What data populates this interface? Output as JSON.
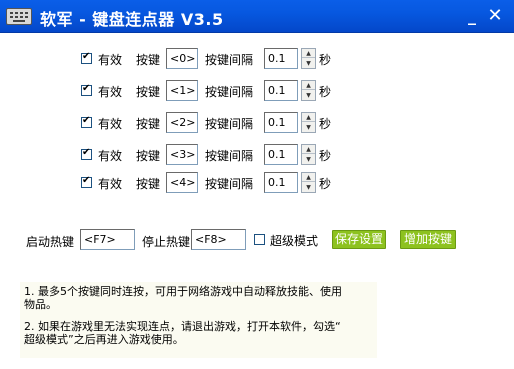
{
  "window": {
    "title": "软军 - 键盘连点器 V3.5",
    "min_label": "_",
    "close_label": "✕",
    "accent": "#0758e0"
  },
  "labels": {
    "enabled": "有效",
    "key": "按键",
    "interval": "按键间隔",
    "seconds": "秒"
  },
  "rows": [
    {
      "enabled": true,
      "key": "<0>",
      "interval": "0.1"
    },
    {
      "enabled": true,
      "key": "<1>",
      "interval": "0.1"
    },
    {
      "enabled": true,
      "key": "<2>",
      "interval": "0.1"
    },
    {
      "enabled": true,
      "key": "<3>",
      "interval": "0.1"
    },
    {
      "enabled": true,
      "key": "<4>",
      "interval": "0.1"
    }
  ],
  "hotkeys": {
    "start_label": "启动热键",
    "start_value": "<F7>",
    "stop_label": "停止热键",
    "stop_value": "<F8>",
    "super_mode_label": "超级模式",
    "super_mode_checked": false
  },
  "buttons": {
    "save": "保存设置",
    "add": "增加按键",
    "color": "#8dc21f"
  },
  "notes": {
    "line1": "1. 最多5个按键同时连按，可用于网络游戏中自动释放技能、使用",
    "line1b": "物品。",
    "line2": "2. 如果在游戏里无法实现连点，请退出游戏，打开本软件，勾选“",
    "line2b": "超级模式”之后再进入游戏使用。"
  }
}
